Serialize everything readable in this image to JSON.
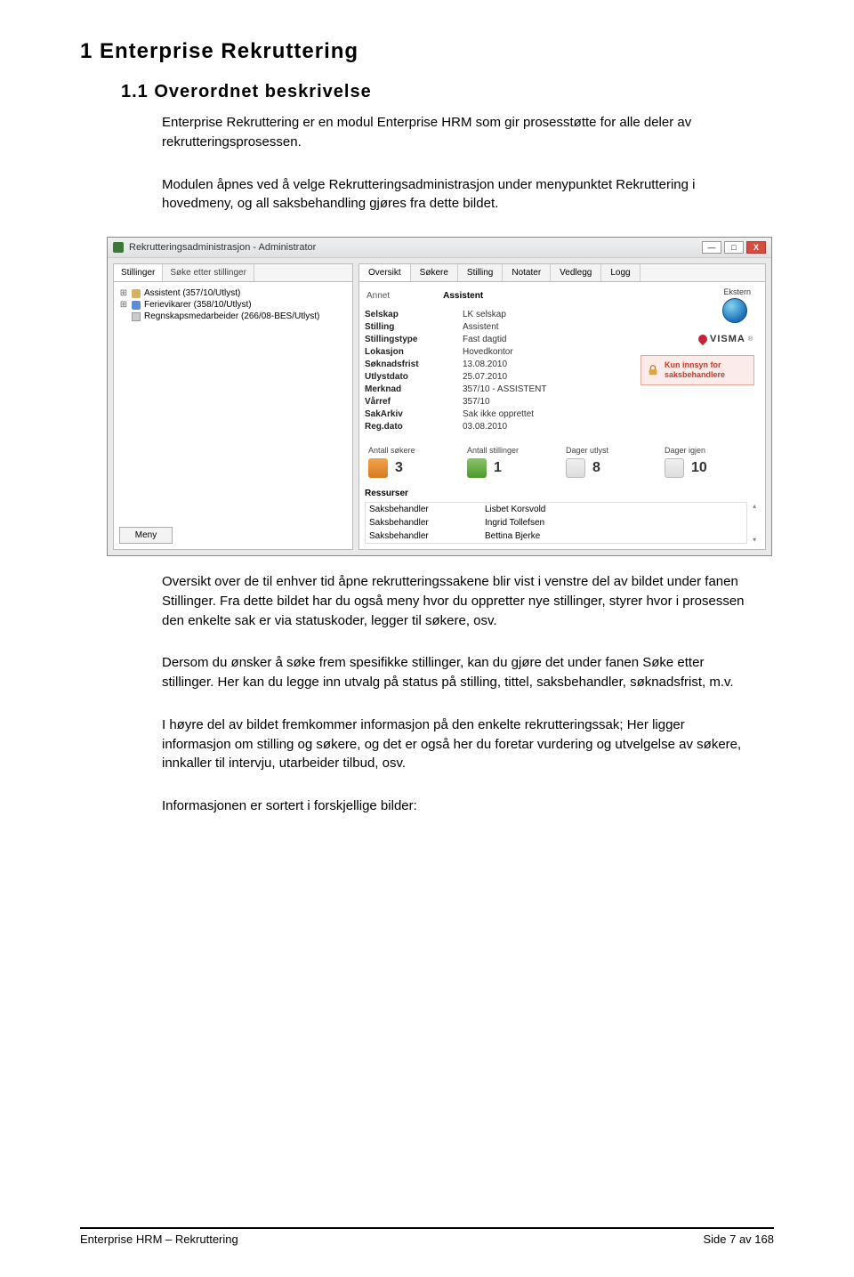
{
  "headings": {
    "h1": "1 Enterprise Rekruttering",
    "h2": "1.1 Overordnet beskrivelse"
  },
  "paragraphs": {
    "p1": "Enterprise Rekruttering er en modul Enterprise HRM som gir prosesstøtte for alle deler av rekrutteringsprosessen.",
    "p2": "Modulen åpnes ved å velge Rekrutteringsadministrasjon under menypunktet Rekruttering i hovedmeny, og all saksbehandling gjøres fra dette bildet.",
    "p3": "Oversikt over de til enhver tid åpne rekrutteringssakene blir vist i venstre del av bildet under fanen Stillinger. Fra dette bildet har du også meny hvor du oppretter nye stillinger, styrer hvor i prosessen den enkelte sak er via statuskoder, legger til søkere, osv.",
    "p4": "Dersom du ønsker å søke frem spesifikke stillinger, kan du gjøre det under fanen Søke etter stillinger. Her kan du legge inn utvalg på status på stilling, tittel, saksbehandler, søknadsfrist, m.v.",
    "p5": "I høyre del av bildet fremkommer informasjon på den enkelte rekrutteringssak; Her ligger informasjon om stilling og søkere, og det er også her du foretar vurdering og utvelgelse av søkere, innkaller til intervju, utarbeider tilbud, osv.",
    "p6": "Informasjonen er sortert i forskjellige bilder:"
  },
  "footer": {
    "left": "Enterprise HRM – Rekruttering",
    "right": "Side 7 av 168"
  },
  "app": {
    "title": "Rekrutteringsadministrasjon - Administrator",
    "left_tabs": {
      "tab1": "Stillinger",
      "tab2": "Søke etter stillinger"
    },
    "tree": {
      "item1": "Assistent (357/10/Utlyst)",
      "item2": "Ferievikarer (358/10/Utlyst)",
      "item3": "Regnskapsmedarbeider (266/08-BES/Utlyst)"
    },
    "menu_btn": "Meny",
    "right_tabs": {
      "t1": "Oversikt",
      "t2": "Søkere",
      "t3": "Stilling",
      "t4": "Notater",
      "t5": "Vedlegg",
      "t6": "Logg"
    },
    "overview": {
      "annet_label": "Annet",
      "title_value": "Assistent",
      "ekstern_label": "Ekstern",
      "fields": [
        {
          "k": "Selskap",
          "v": "LK selskap"
        },
        {
          "k": "Stilling",
          "v": "Assistent"
        },
        {
          "k": "Stillingstype",
          "v": "Fast dagtid"
        },
        {
          "k": "Lokasjon",
          "v": "Hovedkontor"
        },
        {
          "k": "Søknadsfrist",
          "v": "13.08.2010"
        },
        {
          "k": "Utlystdato",
          "v": "25.07.2010"
        },
        {
          "k": "Merknad",
          "v": "357/10 - ASSISTENT"
        },
        {
          "k": "Vårref",
          "v": "357/10"
        },
        {
          "k": "SakArkiv",
          "v": "Sak ikke opprettet"
        },
        {
          "k": "Reg.dato",
          "v": "03.08.2010"
        }
      ],
      "visma": "VISMA",
      "locked_text": "Kun innsyn for saksbehandlere",
      "stats": {
        "s1": {
          "label": "Antall søkere",
          "value": "3"
        },
        "s2": {
          "label": "Antall stillinger",
          "value": "1"
        },
        "s3": {
          "label": "Dager utlyst",
          "value": "8"
        },
        "s4": {
          "label": "Dager igjen",
          "value": "10"
        }
      },
      "ressurser_label": "Ressurser",
      "ressurser": [
        {
          "role": "Saksbehandler",
          "name": "Lisbet Korsvold"
        },
        {
          "role": "Saksbehandler",
          "name": "Ingrid Tollefsen"
        },
        {
          "role": "Saksbehandler",
          "name": "Bettina Bjerke"
        }
      ]
    }
  }
}
